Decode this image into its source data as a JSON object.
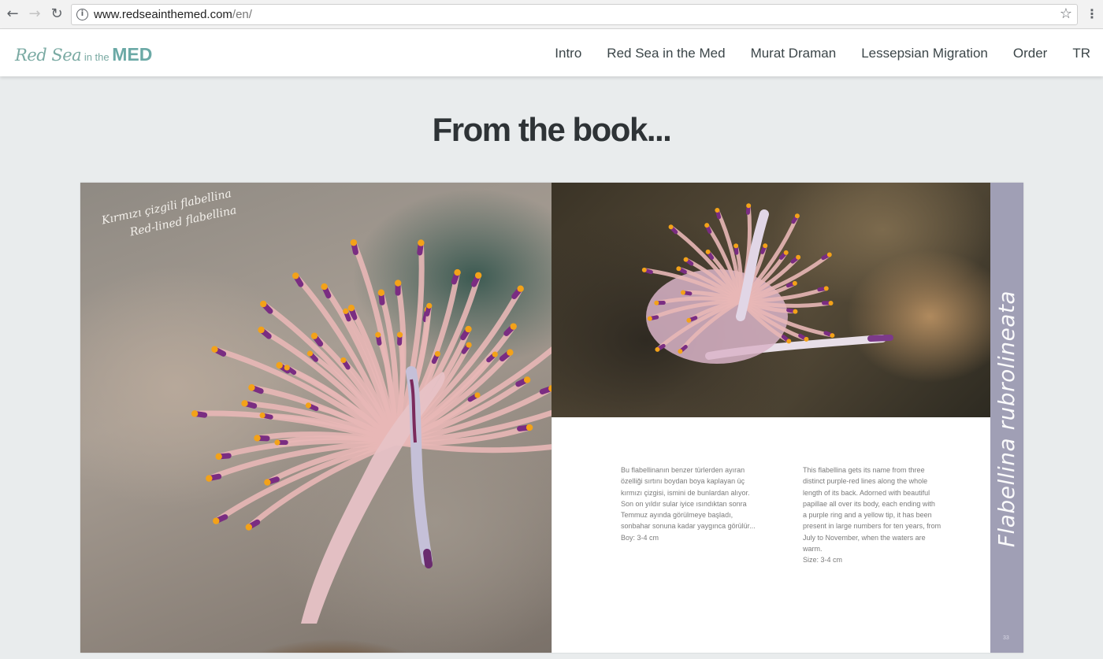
{
  "browser": {
    "back_icon": "arrow-left-icon",
    "forward_icon": "arrow-right-icon",
    "reload_icon": "reload-icon",
    "url_host": "www.redseainthemed.com",
    "url_path": "/en/",
    "info_glyph": "i"
  },
  "header": {
    "logo": {
      "part1": "Red Sea",
      "part2": " in the ",
      "part3": "MED"
    },
    "nav": [
      {
        "label": "Intro"
      },
      {
        "label": "Red Sea in the Med"
      },
      {
        "label": "Murat Draman"
      },
      {
        "label": "Lessepsian Migration"
      },
      {
        "label": "Order"
      },
      {
        "label": "TR"
      }
    ],
    "colors": {
      "logo": "#7aaaa3",
      "nav_text": "#3b4548"
    }
  },
  "main": {
    "title": "From the book...",
    "spread": {
      "caption_line1": "Kırmızı çizgili flabellina",
      "caption_line2": "Red-lined flabellina",
      "species_name": "Flabellina rubrolineata",
      "page_number": "33",
      "text_tr": "Bu flabellinanın benzer türlerden ayıran\nözelliği sırtını boydan boya kaplayan üç\nkırmızı çizgisi, ismini de bunlardan alıyor.\nSon on yıldır sular iyice ısındıktan sonra\nTemmuz ayında görülmeye başladı,\nsonbahar sonuna kadar yaygınca görülür...\nBoy: 3-4 cm",
      "text_en": "This flabellina gets its name from three\ndistinct purple-red lines along the whole\nlength of its back. Adorned with beautiful\npapillae all over its body, each ending with\na purple ring and a yellow tip, it has been\npresent in large numbers for ten years, from\nJuly to November, when the waters are\nwarm.\nSize: 3-4 cm",
      "colors": {
        "side_strip": "#a09fb5",
        "page_bg": "#e9eced"
      }
    }
  }
}
